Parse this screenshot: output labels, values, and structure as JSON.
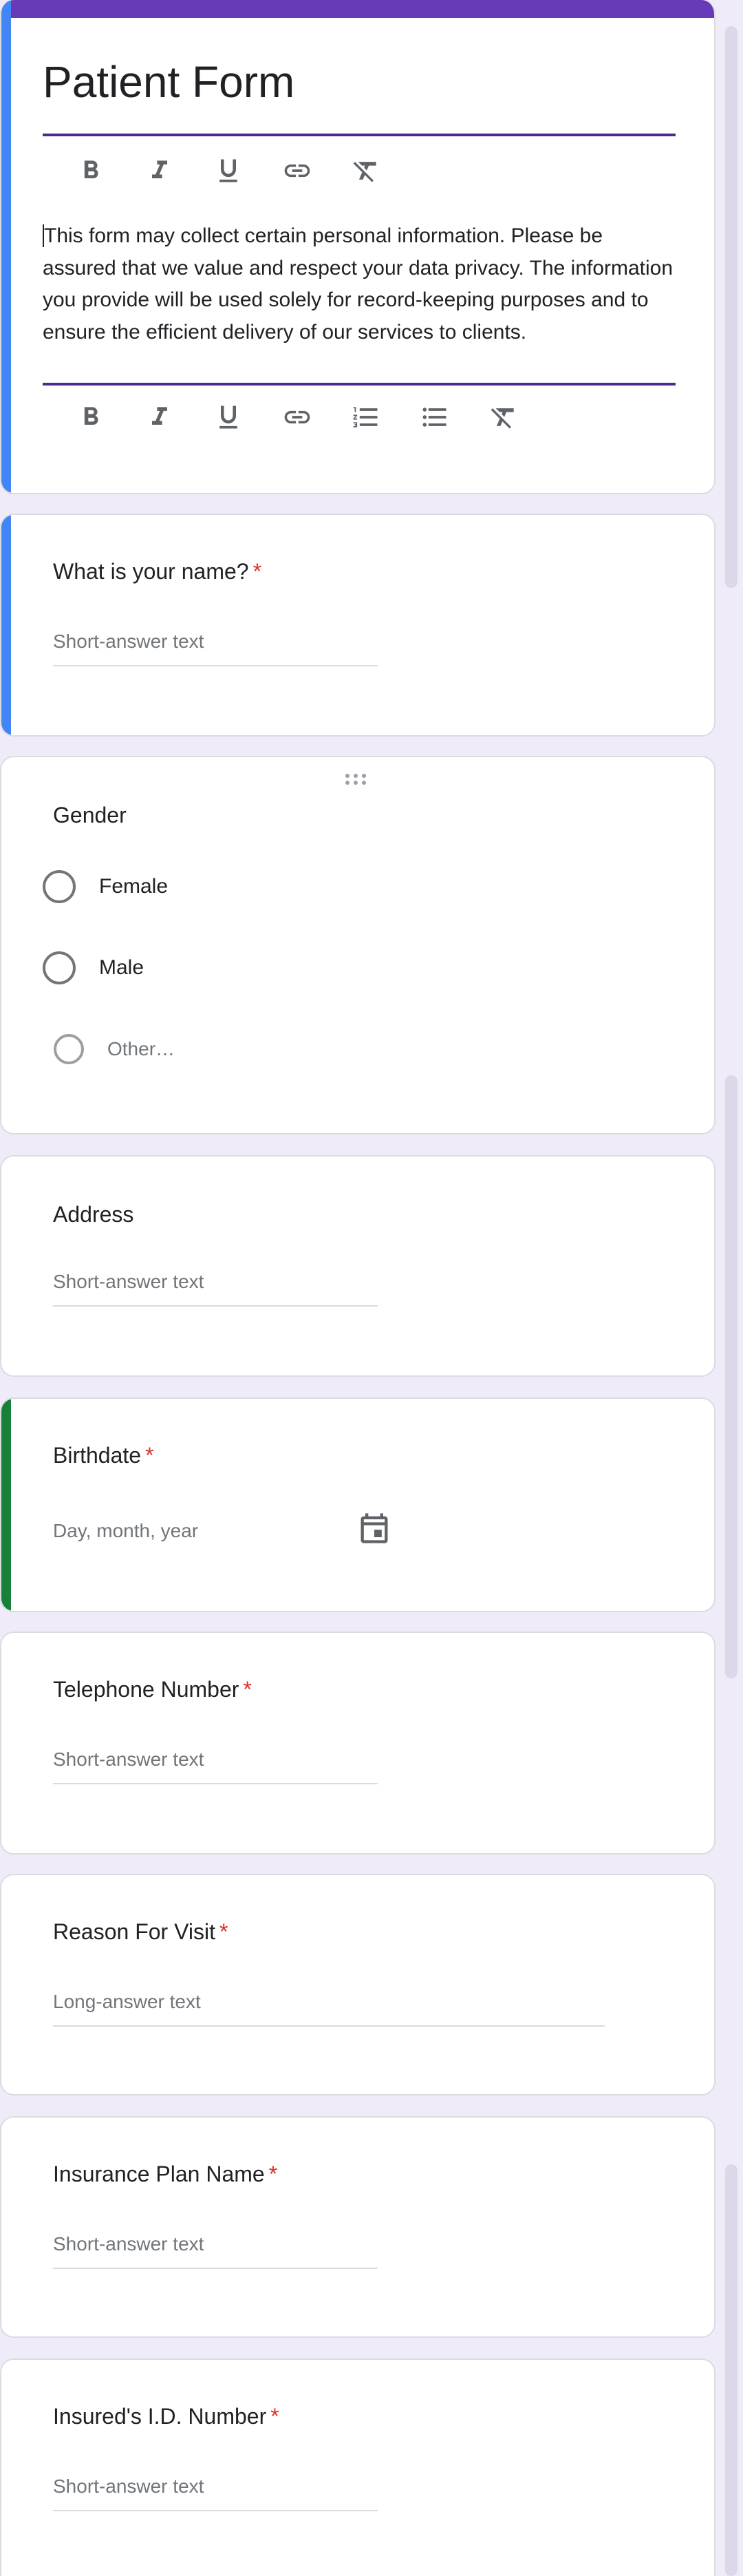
{
  "form": {
    "title": "Patient Form",
    "description": "This form may collect certain personal information. Please be assured that we value and respect your data privacy. The information you provide will be used solely for record-keeping purposes and to ensure the efficient delivery of our services to clients."
  },
  "toolbar_title": [
    "bold-icon",
    "italic-icon",
    "underline-icon",
    "link-icon",
    "clear-format-icon"
  ],
  "toolbar_description": [
    "bold-icon",
    "italic-icon",
    "underline-icon",
    "link-icon",
    "numbered-list-icon",
    "bulleted-list-icon",
    "clear-format-icon"
  ],
  "colors": {
    "header_accent": "#673ab7",
    "active_blue": "#4285f4",
    "active_green": "#188038",
    "required": "#d93025",
    "background": "#efebf8"
  },
  "questions": {
    "name": {
      "title": "What is your name?",
      "required": "*",
      "placeholder": "Short-answer text"
    },
    "gender": {
      "title": "Gender",
      "options": [
        "Female",
        "Male"
      ],
      "other_label": "Other…"
    },
    "address": {
      "title": "Address",
      "placeholder": "Short-answer text"
    },
    "birthdate": {
      "title": "Birthdate",
      "required": "*",
      "placeholder": "Day, month, year"
    },
    "telephone": {
      "title": "Telephone Number",
      "required": "*",
      "placeholder": "Short-answer text"
    },
    "reason": {
      "title": "Reason For Visit",
      "required": "*",
      "placeholder": "Long-answer text"
    },
    "insurance_plan": {
      "title": "Insurance Plan Name",
      "required": "*",
      "placeholder": "Short-answer text"
    },
    "insured_id": {
      "title": "Insured's I.D. Number",
      "required": "*",
      "placeholder": "Short-answer text"
    }
  }
}
